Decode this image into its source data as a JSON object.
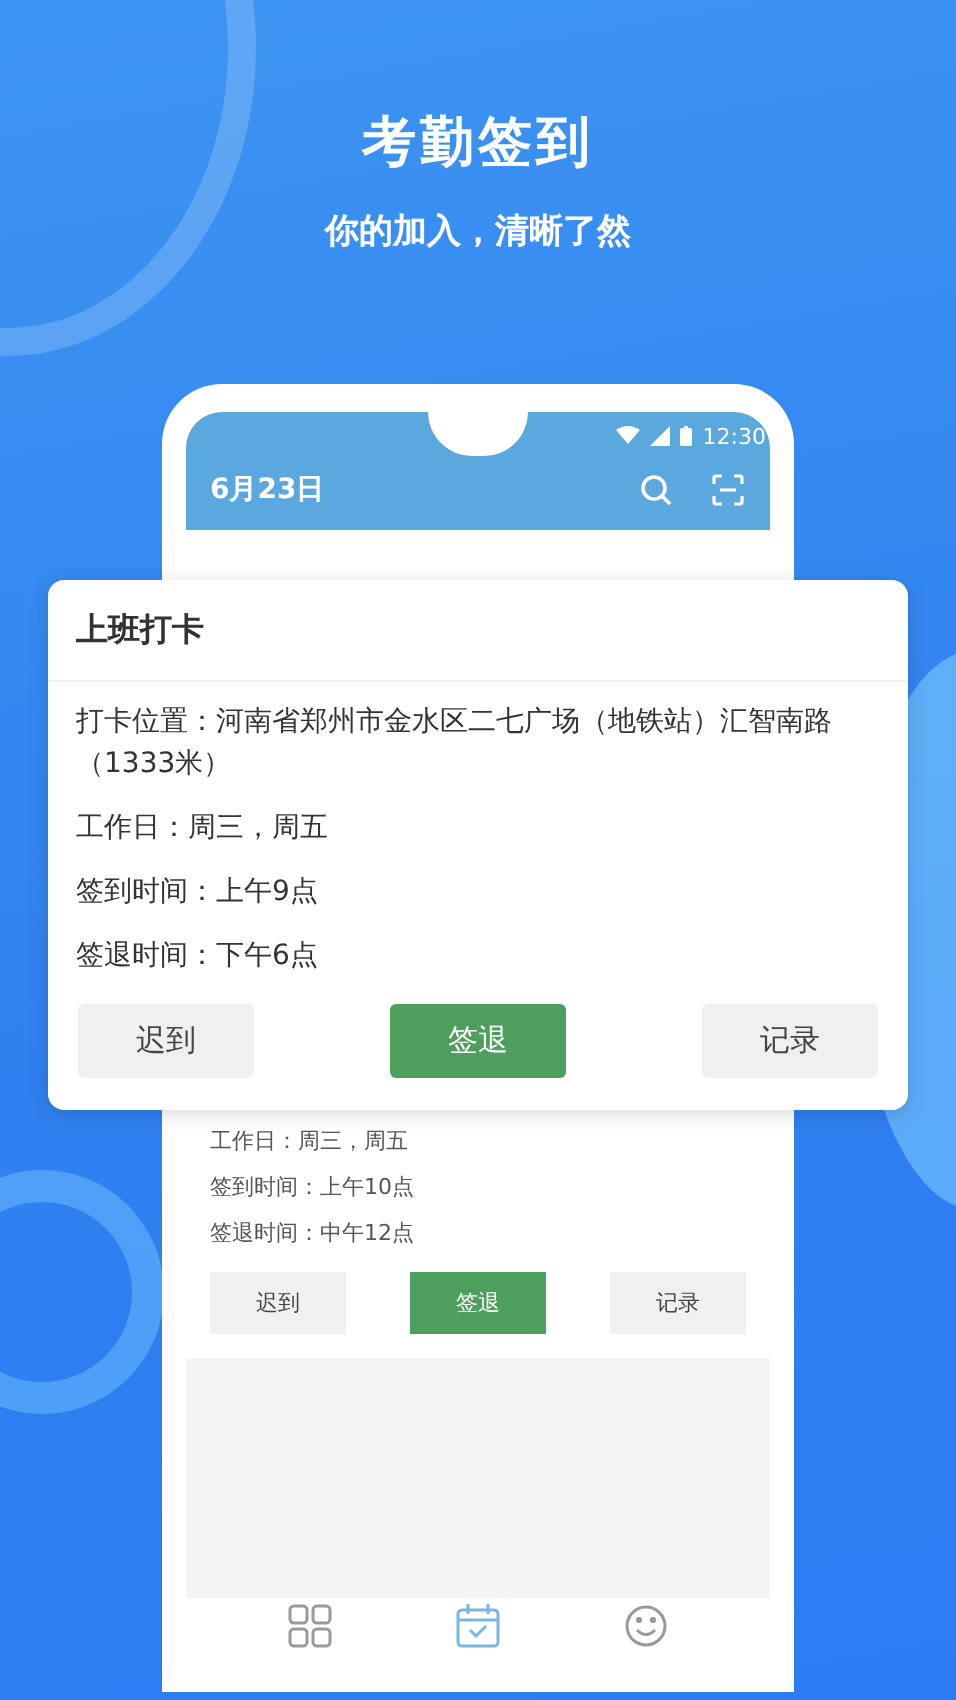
{
  "header": {
    "title": "考勤签到",
    "subtitle": "你的加入，清晰了然"
  },
  "phone": {
    "status_bar": {
      "time": "12:30"
    },
    "app_bar": {
      "date": "6月23日"
    },
    "card": {
      "details": [
        "工作日：周三，周五",
        "签到时间：上午10点",
        "签退时间：中午12点"
      ],
      "buttons": [
        {
          "label": "迟到",
          "kind": "plain"
        },
        {
          "label": "签退",
          "kind": "primary"
        },
        {
          "label": "记录",
          "kind": "plain"
        }
      ]
    },
    "tab_bar": [
      {
        "kind": "grid",
        "selected": false
      },
      {
        "kind": "calendar",
        "selected": true
      },
      {
        "kind": "smiley",
        "selected": false
      }
    ]
  },
  "dialog": {
    "title": "上班打卡",
    "details": [
      "打卡位置：河南省郑州市金水区二七广场（地铁站）汇智南路（1333米）",
      "工作日：周三，周五",
      "签到时间：上午9点",
      "签退时间：下午6点"
    ],
    "buttons": [
      {
        "label": "迟到",
        "kind": "plain"
      },
      {
        "label": "签退",
        "kind": "primary"
      },
      {
        "label": "记录",
        "kind": "plain"
      }
    ]
  }
}
